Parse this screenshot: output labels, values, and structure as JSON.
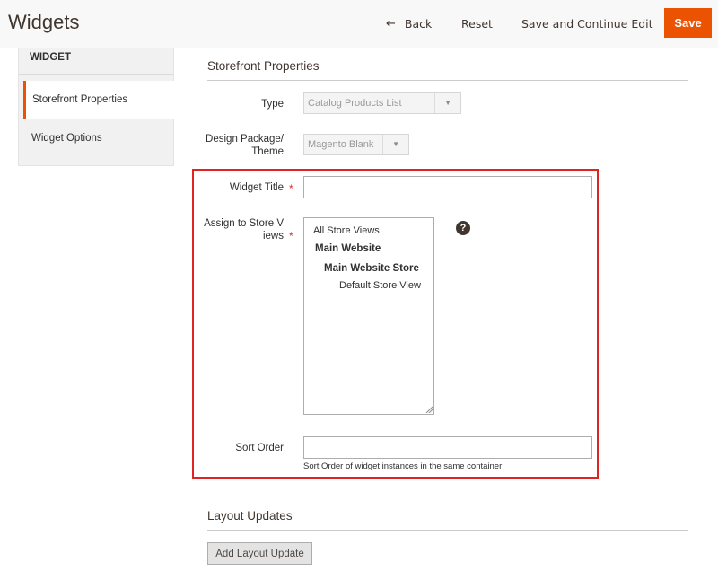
{
  "header": {
    "title": "Widgets",
    "back_label": "Back",
    "reset_label": "Reset",
    "save_continue_label": "Save and Continue Edit",
    "save_label": "Save"
  },
  "sidebar": {
    "title": "WIDGET",
    "items": [
      {
        "label": "Storefront Properties",
        "active": true
      },
      {
        "label": "Widget Options",
        "active": false
      }
    ]
  },
  "storefront": {
    "section_title": "Storefront Properties",
    "type": {
      "label": "Type",
      "value": "Catalog Products List"
    },
    "theme": {
      "label_line1": "Design Package/",
      "label_line2": "Theme",
      "value": "Magento Blank"
    },
    "widget_title": {
      "label": "Widget Title",
      "value": "",
      "required_mark": "*"
    },
    "store_views": {
      "label_line1": "Assign to Store V",
      "label_line2": "iews",
      "required_mark": "*",
      "options": [
        "All Store Views",
        "Main Website",
        "Main Website Store",
        "Default Store View"
      ],
      "help_glyph": "?"
    },
    "sort_order": {
      "label": "Sort Order",
      "value": "",
      "note": "Sort Order of widget instances in the same container"
    }
  },
  "layout_updates": {
    "section_title": "Layout Updates",
    "add_button_label": "Add Layout Update"
  },
  "colors": {
    "accent": "#eb5202",
    "highlight": "#e02424"
  }
}
